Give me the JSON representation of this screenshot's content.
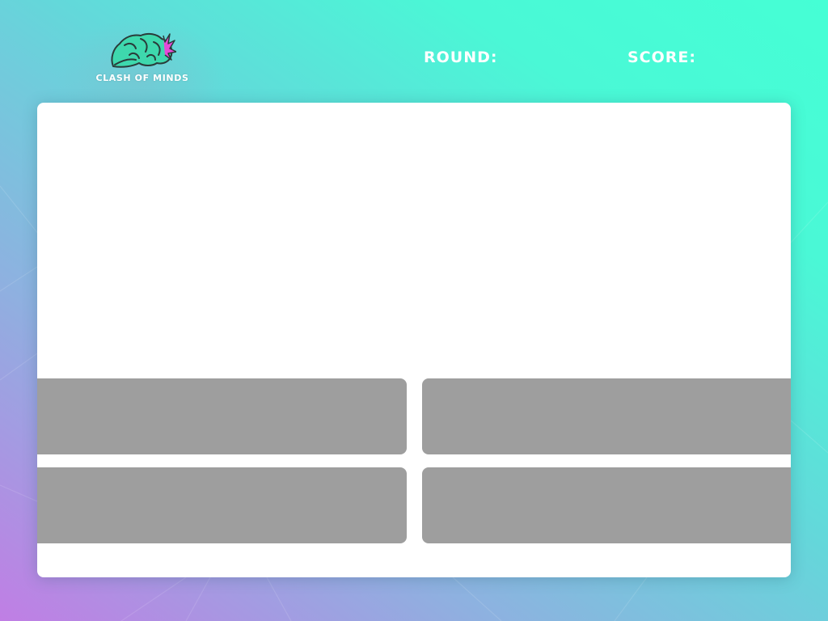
{
  "app": {
    "logo_title": "CLASH OF MINDS",
    "logo_icon": "brain-icon",
    "accent_color": "#e64ad8",
    "brain_color": "#3ed8ad"
  },
  "header": {
    "round_label": "ROUND:",
    "round_value": "",
    "score_label": "SCORE:",
    "score_value": ""
  },
  "question": {
    "text": ""
  },
  "answers": [
    {
      "label": ""
    },
    {
      "label": ""
    },
    {
      "label": ""
    },
    {
      "label": ""
    }
  ],
  "colors": {
    "card_background": "#ffffff",
    "answer_background": "#9e9e9e",
    "background_gradient_start": "#c07ee4",
    "background_gradient_end": "#45ffd5"
  }
}
